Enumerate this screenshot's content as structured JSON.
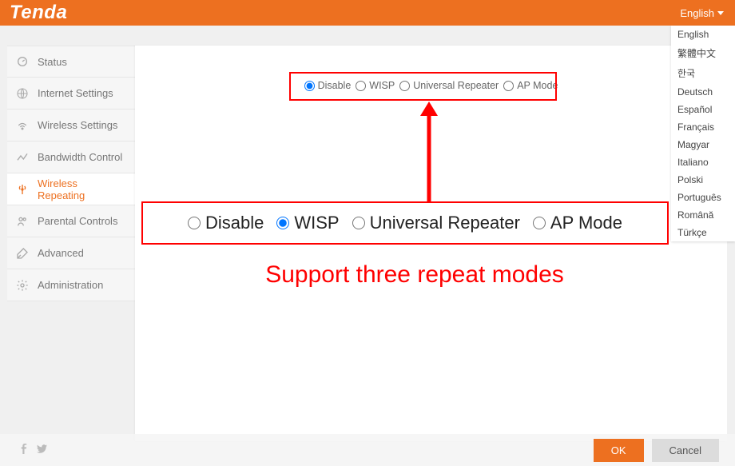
{
  "header": {
    "brand": "Tenda",
    "current_lang": "English"
  },
  "lang_menu": [
    "English",
    "繁體中文",
    "한국",
    "Deutsch",
    "Español",
    "Français",
    "Magyar",
    "Italiano",
    "Polski",
    "Português",
    "Română",
    "Türkçe"
  ],
  "sidebar": [
    {
      "label": "Status"
    },
    {
      "label": "Internet Settings"
    },
    {
      "label": "Wireless Settings"
    },
    {
      "label": "Bandwidth Control"
    },
    {
      "label": "Wireless Repeating"
    },
    {
      "label": "Parental Controls"
    },
    {
      "label": "Advanced"
    },
    {
      "label": "Administration"
    }
  ],
  "active_sidebar_index": 4,
  "modes": [
    {
      "label": "Disable"
    },
    {
      "label": "WISP"
    },
    {
      "label": "Universal Repeater"
    },
    {
      "label": "AP Mode"
    }
  ],
  "top_selected_index": 0,
  "zoom_selected_index": 1,
  "annotation_caption": "Support three repeat modes",
  "footer": {
    "ok": "OK",
    "cancel": "Cancel"
  }
}
